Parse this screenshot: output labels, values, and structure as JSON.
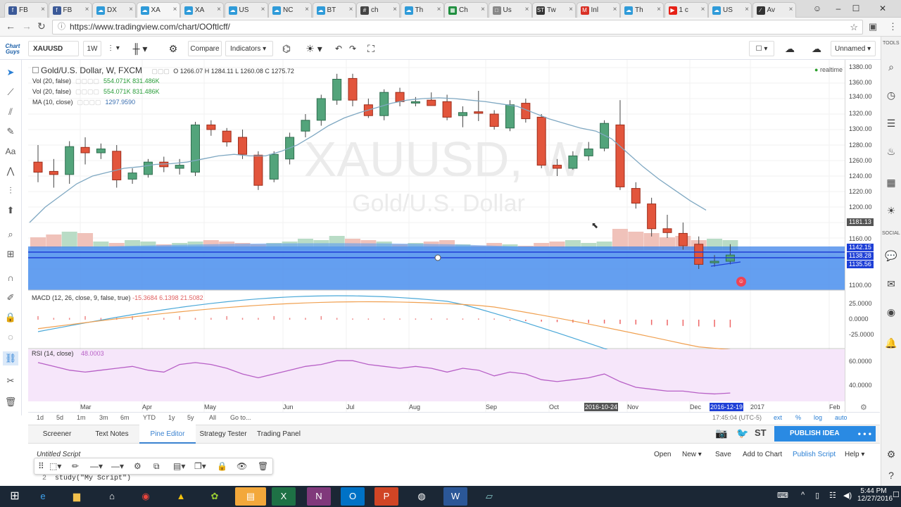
{
  "browser": {
    "tabs": [
      {
        "icon": "facebook-icon",
        "label": "FB",
        "color": "#3b5998",
        "glyph": "f"
      },
      {
        "icon": "facebook-icon",
        "label": "FB",
        "color": "#3b5998",
        "glyph": "f"
      },
      {
        "icon": "tradingview-icon",
        "label": "DX",
        "color": "#2f9bd9",
        "glyph": "☁"
      },
      {
        "icon": "tradingview-icon",
        "label": "XA",
        "color": "#2f9bd9",
        "glyph": "☁"
      },
      {
        "icon": "tradingview-icon",
        "label": "XA",
        "color": "#2f9bd9",
        "glyph": "☁"
      },
      {
        "icon": "tradingview-icon",
        "label": "US",
        "color": "#2f9bd9",
        "glyph": "☁"
      },
      {
        "icon": "tradingview-icon",
        "label": "NC",
        "color": "#2f9bd9",
        "glyph": "☁"
      },
      {
        "icon": "tradingview-icon",
        "label": "BT",
        "color": "#2f9bd9",
        "glyph": "☁"
      },
      {
        "icon": "hashtag-icon",
        "label": "ch",
        "color": "#444",
        "glyph": "#"
      },
      {
        "icon": "tradingview-icon",
        "label": "Th",
        "color": "#2f9bd9",
        "glyph": "☁"
      },
      {
        "icon": "sheets-icon",
        "label": "Ch",
        "color": "#1e8e3e",
        "glyph": "▦"
      },
      {
        "icon": "doc-icon",
        "label": "Us",
        "color": "#888",
        "glyph": "□"
      },
      {
        "icon": "st-icon",
        "label": "Tw",
        "color": "#333",
        "glyph": "ST"
      },
      {
        "icon": "gmail-icon",
        "label": "Inl",
        "color": "#d93025",
        "glyph": "M"
      },
      {
        "icon": "tradingview-icon",
        "label": "Th",
        "color": "#2f9bd9",
        "glyph": "☁"
      },
      {
        "icon": "youtube-icon",
        "label": "1 c",
        "color": "#e62117",
        "glyph": "▶"
      },
      {
        "icon": "tradingview-icon",
        "label": "US",
        "color": "#2f9bd9",
        "glyph": "☁"
      },
      {
        "icon": "tradingview-icon",
        "label": "Av",
        "color": "#333",
        "glyph": "∕"
      }
    ],
    "active_tab_index": 3,
    "url": "https://www.tradingview.com/chart/OOftlcff/"
  },
  "toolbar": {
    "logo_line1": "Chart",
    "logo_line2": "Guys",
    "symbol": "XAUUSD",
    "interval": "1W",
    "compare": "Compare",
    "indicators": "Indicators",
    "layout_name": "Unnamed"
  },
  "chart": {
    "title": "Gold/U.S. Dollar, W, FXCM",
    "ohlc": "O 1266.07  H 1284.11  L 1260.08  C 1275.72",
    "legend": [
      {
        "label": "Vol (20, false)",
        "values": "554.071K 831.486K"
      },
      {
        "label": "Vol (20, false)",
        "values": "554.071K 831.486K"
      },
      {
        "label": "MA (10, close)",
        "values": "1297.9590"
      }
    ],
    "watermark_symbol": "XAUUSD, W",
    "watermark_name": "Gold/U.S. Dollar",
    "realtime": "realtime",
    "price_labels": [
      "1380.00",
      "1360.00",
      "1340.00",
      "1320.00",
      "1300.00",
      "1280.00",
      "1260.00",
      "1240.00",
      "1220.00",
      "1200.00",
      "1160.00",
      "1100.00"
    ],
    "price_badges": [
      {
        "text": "1181.13",
        "color": "#555555"
      },
      {
        "text": "1142.15",
        "color": "#1e3fd6"
      },
      {
        "text": "1138.28",
        "color": "#1e3fd6"
      },
      {
        "text": "1135.56",
        "color": "#1e3fd6"
      }
    ],
    "macd_legend": "MACD (12, 26, close, 9, false, true)",
    "macd_values": "-15.3684  6.1398  21.5082",
    "macd_labels": [
      "25.0000",
      "0.0000",
      "-25.0000"
    ],
    "rsi_legend": "RSI (14, close)",
    "rsi_value": "48.0003",
    "rsi_labels": [
      "60.0000",
      "40.0000"
    ],
    "time_labels": [
      "Mar",
      "Apr",
      "May",
      "Jun",
      "Jul",
      "Aug",
      "Sep",
      "Oct",
      "Nov",
      "Dec",
      "2017",
      "Feb"
    ],
    "time_highlight_1": "2016-10-24",
    "time_highlight_2": "2016-12-19"
  },
  "timebar": {
    "ranges": [
      "1d",
      "5d",
      "1m",
      "3m",
      "6m",
      "YTD",
      "1y",
      "5y",
      "All",
      "Go to..."
    ],
    "clock": "17:45:04 (UTC-5)",
    "options": [
      "ext",
      "%",
      "log",
      "auto"
    ]
  },
  "bottom_tabs": [
    "Screener",
    "Text Notes",
    "Pine Editor",
    "Strategy Tester",
    "Trading Panel"
  ],
  "active_bottom_tab": "Pine Editor",
  "editor": {
    "script_name": "Untitled Script",
    "actions": [
      "Open",
      "New",
      "Save",
      "Add to Chart",
      "Publish Script",
      "Help"
    ],
    "code_line_no": "2",
    "code_line": "study(\"My Script\")"
  },
  "right_panel": {
    "tools_label": "TOOLS",
    "social_label": "SOCIAL",
    "publish_button": "PUBLISH IDEA",
    "st_label": "ST"
  },
  "taskbar": {
    "time": "5:44 PM",
    "date": "12/27/2016"
  }
}
